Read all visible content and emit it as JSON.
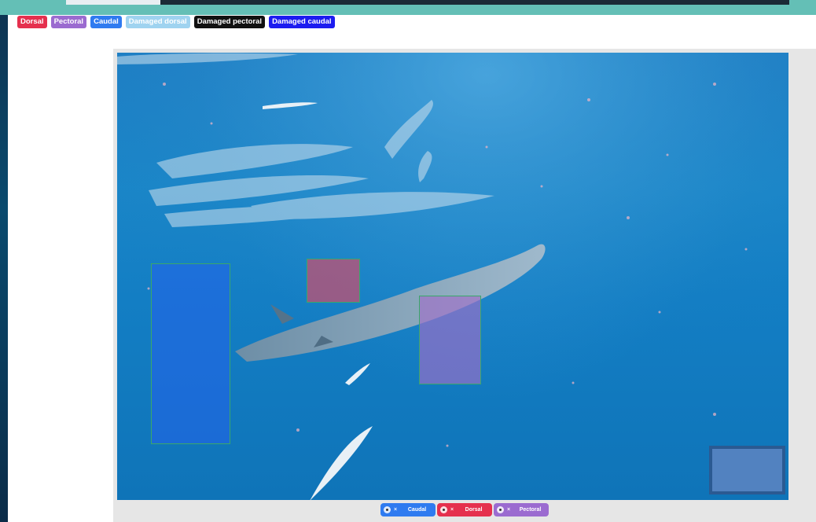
{
  "legend": {
    "labels": [
      {
        "text": "Dorsal",
        "color": "#e5304e"
      },
      {
        "text": "Pectoral",
        "color": "#9b6bd0"
      },
      {
        "text": "Caudal",
        "color": "#2f7bf0"
      },
      {
        "text": "Damaged dorsal",
        "color": "#9fd3f0"
      },
      {
        "text": "Damaged pectoral",
        "color": "#111111"
      },
      {
        "text": "Damaged caudal",
        "color": "#1c1cf0"
      }
    ]
  },
  "annotations": {
    "caudal": {
      "label": "Caudal",
      "color": "#2563eb"
    },
    "dorsal": {
      "label": "Dorsal",
      "color": "#e6465f"
    },
    "pectoral": {
      "label": "Pectoral",
      "color": "#a06ec8"
    }
  },
  "tags": [
    {
      "label": "Caudal",
      "close": "×",
      "color": "#2f7bf0"
    },
    {
      "label": "Dorsal",
      "close": "×",
      "color": "#e5304e"
    },
    {
      "label": "Pectoral",
      "close": "×",
      "color": "#9b6bd0"
    }
  ],
  "icons": {
    "eye": "eye-icon",
    "close": "close-icon"
  }
}
